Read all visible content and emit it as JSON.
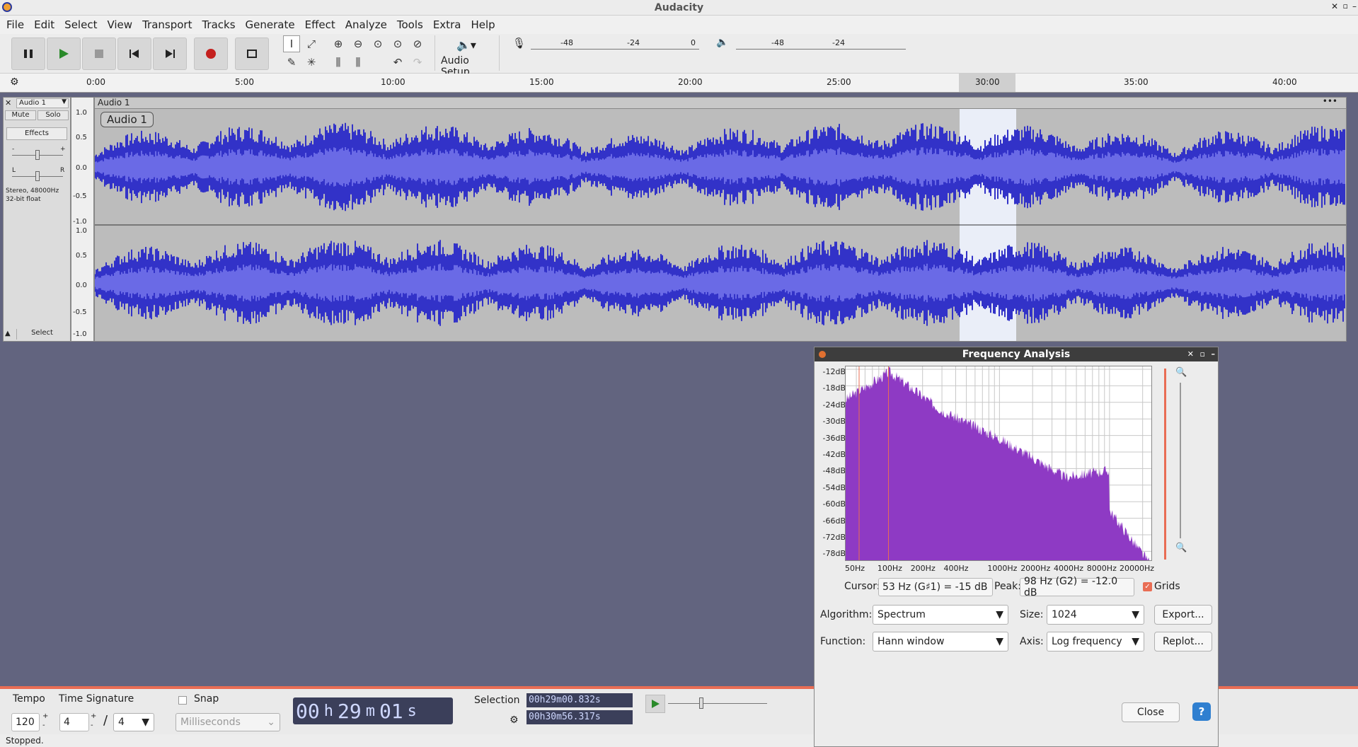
{
  "window": {
    "title": "Audacity"
  },
  "menu": [
    "File",
    "Edit",
    "Select",
    "View",
    "Transport",
    "Tracks",
    "Generate",
    "Effect",
    "Analyze",
    "Tools",
    "Extra",
    "Help"
  ],
  "toolbar": {
    "audio_setup": "Audio Setup",
    "rec_meter": [
      "-48",
      "-24",
      "0"
    ],
    "play_meter": [
      "-48",
      "-24"
    ]
  },
  "ruler": {
    "labels": [
      "0:00",
      "5:00",
      "10:00",
      "15:00",
      "20:00",
      "25:00",
      "30:00",
      "35:00",
      "40:00"
    ]
  },
  "track": {
    "name": "Audio 1",
    "clip_name": "Audio 1",
    "mute": "Mute",
    "solo": "Solo",
    "effects": "Effects",
    "info_line1": "Stereo, 48000Hz",
    "info_line2": "32-bit float",
    "select": "Select",
    "pan_l": "L",
    "pan_r": "R",
    "gain_minus": "-",
    "gain_plus": "+",
    "vruler": [
      "1.0",
      "0.5",
      "0.0",
      "-0.5",
      "-1.0"
    ]
  },
  "dialog": {
    "title": "Frequency Analysis",
    "db_labels": [
      "-12dB",
      "-18dB",
      "-24dB",
      "-30dB",
      "-36dB",
      "-42dB",
      "-48dB",
      "-54dB",
      "-60dB",
      "-66dB",
      "-72dB",
      "-78dB"
    ],
    "hz_labels": [
      "50Hz",
      "100Hz",
      "200Hz",
      "400Hz",
      "1000Hz",
      "2000Hz",
      "4000Hz",
      "8000Hz",
      "20000Hz"
    ],
    "cursor_label": "Cursor:",
    "cursor_value": "53 Hz (G♯1) = -15 dB",
    "peak_label": "Peak:",
    "peak_value": "98 Hz (G2) = -12.0 dB",
    "grids_label": "Grids",
    "algorithm_label": "Algorithm:",
    "algorithm_value": "Spectrum",
    "size_label": "Size:",
    "size_value": "1024",
    "function_label": "Function:",
    "function_value": "Hann window",
    "axis_label": "Axis:",
    "axis_value": "Log frequency",
    "export": "Export...",
    "replot": "Replot...",
    "close": "Close",
    "help": "?"
  },
  "bottom": {
    "tempo_label": "Tempo",
    "tempo_value": "120",
    "timesig_label": "Time Signature",
    "timesig_num": "4",
    "timesig_den": "4",
    "snap_label": "Snap",
    "snap_unit": "Milliseconds",
    "time": {
      "h": "00",
      "m": "29",
      "s": "01"
    },
    "selection_label": "Selection",
    "sel_start": "00h29m00.832s",
    "sel_end": "00h30m56.317s"
  },
  "status": "Stopped.",
  "colors": {
    "wave": "#3232c8",
    "spectrum": "#8e3ac4",
    "accent": "#e96d54"
  }
}
